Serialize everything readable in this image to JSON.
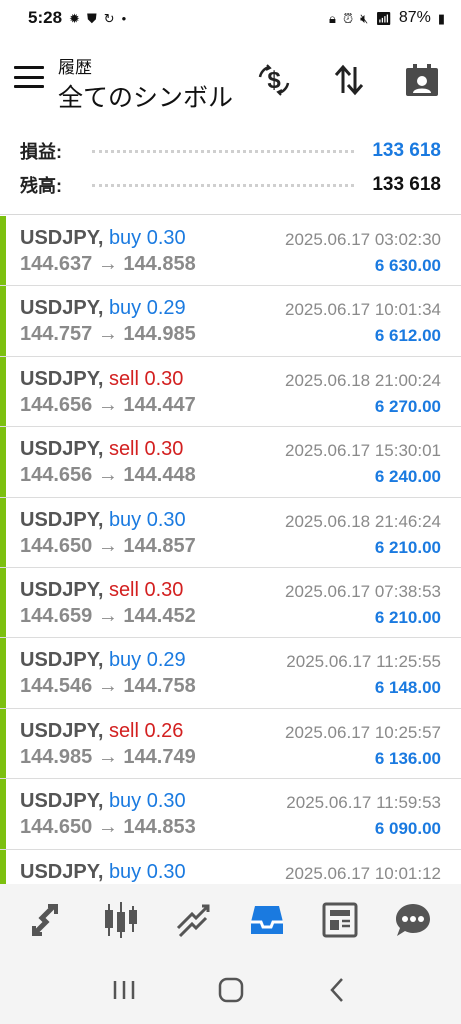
{
  "status_bar": {
    "time": "5:28",
    "battery": "87%"
  },
  "header": {
    "subtitle": "履歴",
    "title": "全てのシンボル"
  },
  "summary": {
    "profit_label": "損益:",
    "profit_value": "133 618",
    "balance_label": "残高:",
    "balance_value": "133 618"
  },
  "trades": [
    {
      "symbol": "USDJPY,",
      "direction": "buy",
      "volume": "0.30",
      "direction_text": "buy 0.30",
      "open": "144.637",
      "close": "144.858",
      "prices": "144.637 → 144.858",
      "time": "2025.06.17 03:02:30",
      "profit": "6 630.00"
    },
    {
      "symbol": "USDJPY,",
      "direction": "buy",
      "volume": "0.29",
      "direction_text": "buy 0.29",
      "open": "144.757",
      "close": "144.985",
      "prices": "144.757 → 144.985",
      "time": "2025.06.17 10:01:34",
      "profit": "6 612.00"
    },
    {
      "symbol": "USDJPY,",
      "direction": "sell",
      "volume": "0.30",
      "direction_text": "sell 0.30",
      "open": "144.656",
      "close": "144.447",
      "prices": "144.656 → 144.447",
      "time": "2025.06.18 21:00:24",
      "profit": "6 270.00"
    },
    {
      "symbol": "USDJPY,",
      "direction": "sell",
      "volume": "0.30",
      "direction_text": "sell 0.30",
      "open": "144.656",
      "close": "144.448",
      "prices": "144.656 → 144.448",
      "time": "2025.06.17 15:30:01",
      "profit": "6 240.00"
    },
    {
      "symbol": "USDJPY,",
      "direction": "buy",
      "volume": "0.30",
      "direction_text": "buy 0.30",
      "open": "144.650",
      "close": "144.857",
      "prices": "144.650 → 144.857",
      "time": "2025.06.18 21:46:24",
      "profit": "6 210.00"
    },
    {
      "symbol": "USDJPY,",
      "direction": "sell",
      "volume": "0.30",
      "direction_text": "sell 0.30",
      "open": "144.659",
      "close": "144.452",
      "prices": "144.659 → 144.452",
      "time": "2025.06.17 07:38:53",
      "profit": "6 210.00"
    },
    {
      "symbol": "USDJPY,",
      "direction": "buy",
      "volume": "0.29",
      "direction_text": "buy 0.29",
      "open": "144.546",
      "close": "144.758",
      "prices": "144.546 → 144.758",
      "time": "2025.06.17 11:25:55",
      "profit": "6 148.00"
    },
    {
      "symbol": "USDJPY,",
      "direction": "sell",
      "volume": "0.26",
      "direction_text": "sell 0.26",
      "open": "144.985",
      "close": "144.749",
      "prices": "144.985 → 144.749",
      "time": "2025.06.17 10:25:57",
      "profit": "6 136.00"
    },
    {
      "symbol": "USDJPY,",
      "direction": "buy",
      "volume": "0.30",
      "direction_text": "buy 0.30",
      "open": "144.650",
      "close": "144.853",
      "prices": "144.650 → 144.853",
      "time": "2025.06.17 11:59:53",
      "profit": "6 090.00"
    },
    {
      "symbol": "USDJPY,",
      "direction": "buy",
      "volume": "0.30",
      "direction_text": "buy 0.30",
      "open": "",
      "close": "",
      "prices": "",
      "time": "2025.06.17 10:01:12",
      "profit": ""
    }
  ],
  "bottom_nav": [
    {
      "icon": "quotes-icon",
      "active": false
    },
    {
      "icon": "chart-icon",
      "active": false
    },
    {
      "icon": "trade-icon",
      "active": false
    },
    {
      "icon": "history-icon",
      "active": true
    },
    {
      "icon": "news-icon",
      "active": false
    },
    {
      "icon": "messages-icon",
      "active": false
    }
  ],
  "colors": {
    "accent_blue": "#1a7ae0",
    "sell_red": "#d32020",
    "profit_bar": "#7cc00f",
    "nav_icon": "#555555"
  }
}
